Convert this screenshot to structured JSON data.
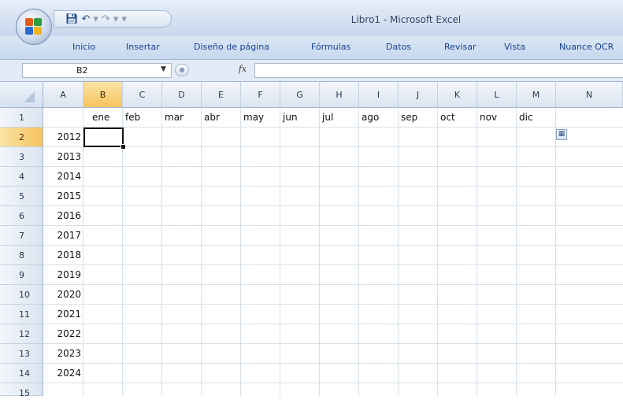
{
  "window": {
    "title": "Libro1 - Microsoft Excel"
  },
  "ribbon": {
    "tabs": [
      "Inicio",
      "Insertar",
      "Diseño de página",
      "Fórmulas",
      "Datos",
      "Revisar",
      "Vista",
      "Nuance OCR"
    ]
  },
  "formula_bar": {
    "name_box": "B2",
    "fx_label": "fx",
    "formula": ""
  },
  "sheet": {
    "columns": [
      "A",
      "B",
      "C",
      "D",
      "E",
      "F",
      "G",
      "H",
      "I",
      "J",
      "K",
      "L",
      "M",
      "N"
    ],
    "rows": [
      "1",
      "2",
      "3",
      "4",
      "5",
      "6",
      "7",
      "8",
      "9",
      "10",
      "11",
      "12",
      "13",
      "14",
      "15"
    ],
    "selected_cell": "B2",
    "month_headers": [
      "ene",
      "feb",
      "mar",
      "abr",
      "may",
      "jun",
      "jul",
      "ago",
      "sep",
      "oct",
      "nov",
      "dic"
    ],
    "years": [
      "2012",
      "2013",
      "2014",
      "2015",
      "2016",
      "2017",
      "2018",
      "2019",
      "2020",
      "2021",
      "2022",
      "2023",
      "2024"
    ]
  },
  "colors": {
    "selected_header": "#f6c45d",
    "ribbon_text": "#15428b",
    "gridline": "#d7e1ec"
  },
  "icons": {
    "office_button": "office-logo-icon",
    "save": "save-icon",
    "undo": "undo-icon",
    "redo": "redo-icon",
    "paste_options": "paste-options-icon"
  }
}
